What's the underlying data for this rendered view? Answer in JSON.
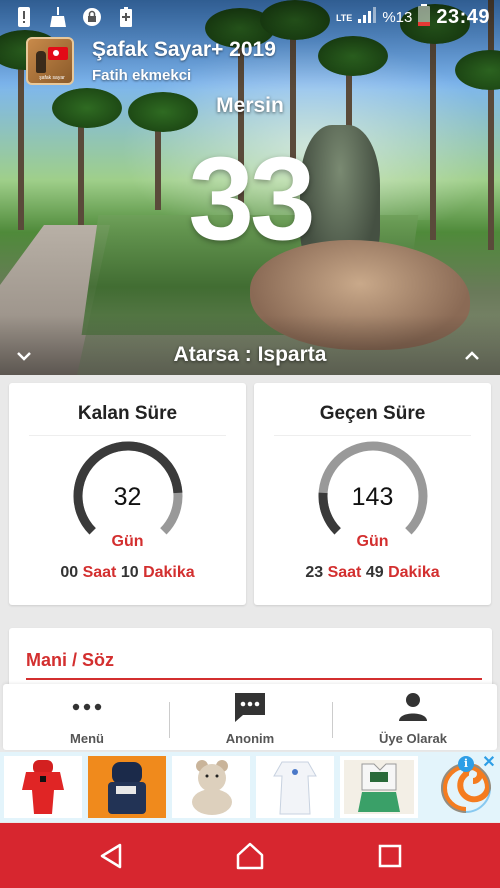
{
  "status_bar": {
    "network": "LTE",
    "battery_percent": "%13",
    "time": "23:49",
    "left_icons": [
      "alert-icon",
      "cleaner-icon",
      "lock-icon",
      "battery-plus-icon"
    ]
  },
  "app": {
    "title": "Şafak Sayar+ 2019",
    "subtitle": "Fatih ekmekci",
    "logo_text": "şafak sayar"
  },
  "hero": {
    "city": "Mersin",
    "plate_number": "33",
    "route": "Atarsa : Isparta"
  },
  "cards": {
    "remaining": {
      "title": "Kalan Süre",
      "value": "32",
      "unit": "Gün",
      "fraction": 0.18,
      "hours": "00",
      "hours_label": "Saat",
      "minutes": "10",
      "minutes_label": "Dakika"
    },
    "elapsed": {
      "title": "Geçen Süre",
      "value": "143",
      "unit": "Gün",
      "fraction": 0.82,
      "hours": "23",
      "hours_label": "Saat",
      "minutes": "49",
      "minutes_label": "Dakika"
    }
  },
  "mani": {
    "title": "Mani / Söz"
  },
  "nav": {
    "items": [
      {
        "label": "Menü",
        "icon": "more-dots-icon"
      },
      {
        "label": "Anonim",
        "icon": "chat-bubble-icon"
      },
      {
        "label": "Üye Olarak",
        "icon": "person-icon"
      }
    ]
  },
  "ad": {
    "info": "i",
    "close": "✕",
    "items": [
      "baby-red-outfit",
      "baby-dark-set",
      "teddy-toy",
      "baby-white-romper",
      "baby-tank-set"
    ]
  },
  "colors": {
    "accent_red": "#d32f2f",
    "system_nav": "#d7262f",
    "ad_blue": "#2e9ee6"
  }
}
